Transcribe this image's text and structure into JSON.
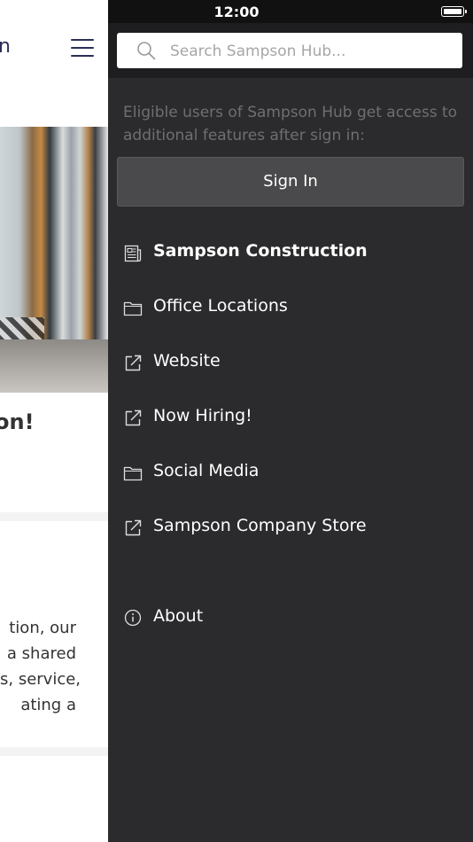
{
  "status_bar": {
    "time": "12:00"
  },
  "background_page": {
    "title_fragment": "n",
    "heading_fragment": "on!",
    "paragraph_lines": [
      "tion, our",
      "a shared",
      "s, service,",
      "ating a"
    ]
  },
  "drawer": {
    "search": {
      "placeholder": "Search Sampson Hub..."
    },
    "notice": "Eligible users of Sampson Hub get access to additional features after sign in:",
    "sign_in_label": "Sign In",
    "menu": [
      {
        "label": "Sampson Construction",
        "icon": "news-icon",
        "active": true
      },
      {
        "label": "Office Locations",
        "icon": "folder-icon"
      },
      {
        "label": "Website",
        "icon": "external-link-icon"
      },
      {
        "label": "Now Hiring!",
        "icon": "external-link-icon"
      },
      {
        "label": "Social Media",
        "icon": "folder-icon"
      },
      {
        "label": "Sampson Company Store",
        "icon": "external-link-icon"
      }
    ],
    "about": {
      "label": "About",
      "icon": "info-icon"
    }
  },
  "colors": {
    "drawer_bg": "#2b2b2d",
    "header_dark": "#1e1e20",
    "button_bg": "#4a4a4c",
    "notice_text": "#6f6f72",
    "brand_navy": "#2b2f55"
  }
}
